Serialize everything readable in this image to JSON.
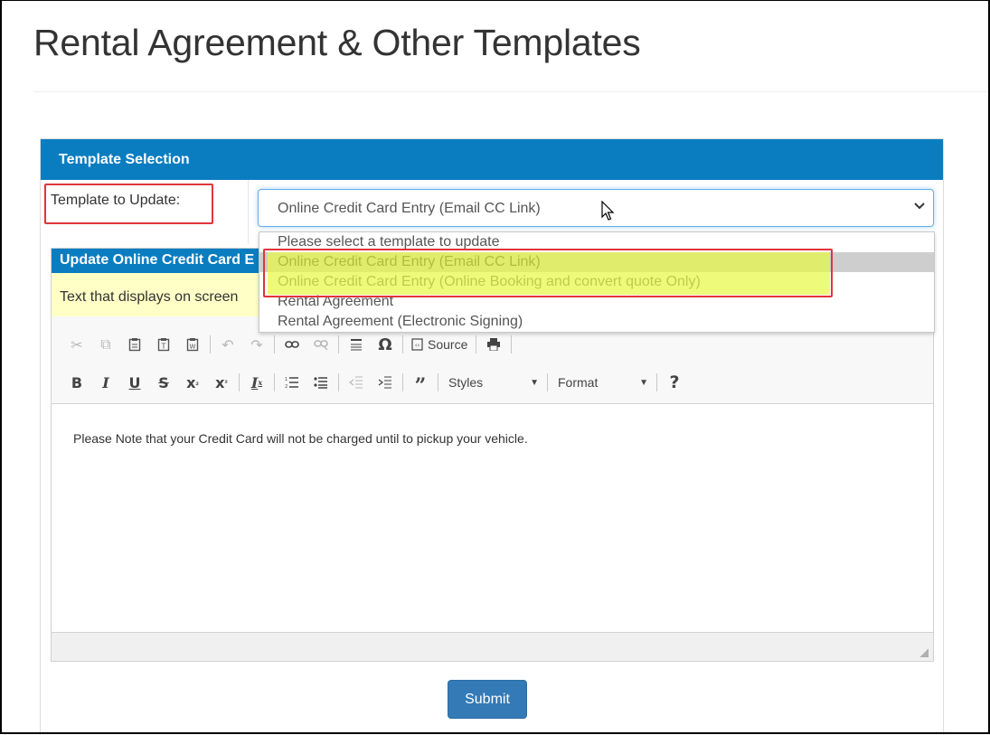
{
  "page": {
    "title": "Rental Agreement & Other Templates"
  },
  "template_selection": {
    "heading": "Template Selection",
    "label": "Template to Update:",
    "selected_value": "Online Credit Card Entry (Email CC Link)",
    "options": [
      "Please select a template to update",
      "Online Credit Card Entry (Email CC Link)",
      "Online Credit Card Entry (Online Booking and convert quote Only)",
      "Rental Agreement",
      "Rental Agreement (Electronic Signing)"
    ]
  },
  "update_panel": {
    "heading": "Update Online Credit Card E",
    "note": "Text that displays on screen"
  },
  "toolbar": {
    "row1": [
      "cut-icon",
      "copy-icon",
      "paste-icon",
      "paste-text-icon",
      "paste-word-icon",
      "undo-icon",
      "redo-icon",
      "link-icon",
      "unlink-icon",
      "horizontal-rule-icon",
      "special-char-icon",
      "source-icon",
      "print-icon"
    ],
    "source_label": "Source",
    "bold": "B",
    "italic": "I",
    "underline": "U",
    "strike": "S",
    "subscript": "x",
    "subscript_mark": "₂",
    "superscript": "x",
    "superscript_mark": "²",
    "remove_format": "I",
    "remove_format_mark": "x",
    "styles_label": "Styles",
    "format_label": "Format",
    "help": "?"
  },
  "editor": {
    "content": "Please Note that your Credit Card will not be charged until to pickup your vehicle."
  },
  "submit_label": "Submit",
  "colors": {
    "header_blue": "#0a7dc1",
    "note_yellow": "#ffffc6",
    "highlight_red": "#e0353b",
    "button_blue": "#337ab7"
  }
}
